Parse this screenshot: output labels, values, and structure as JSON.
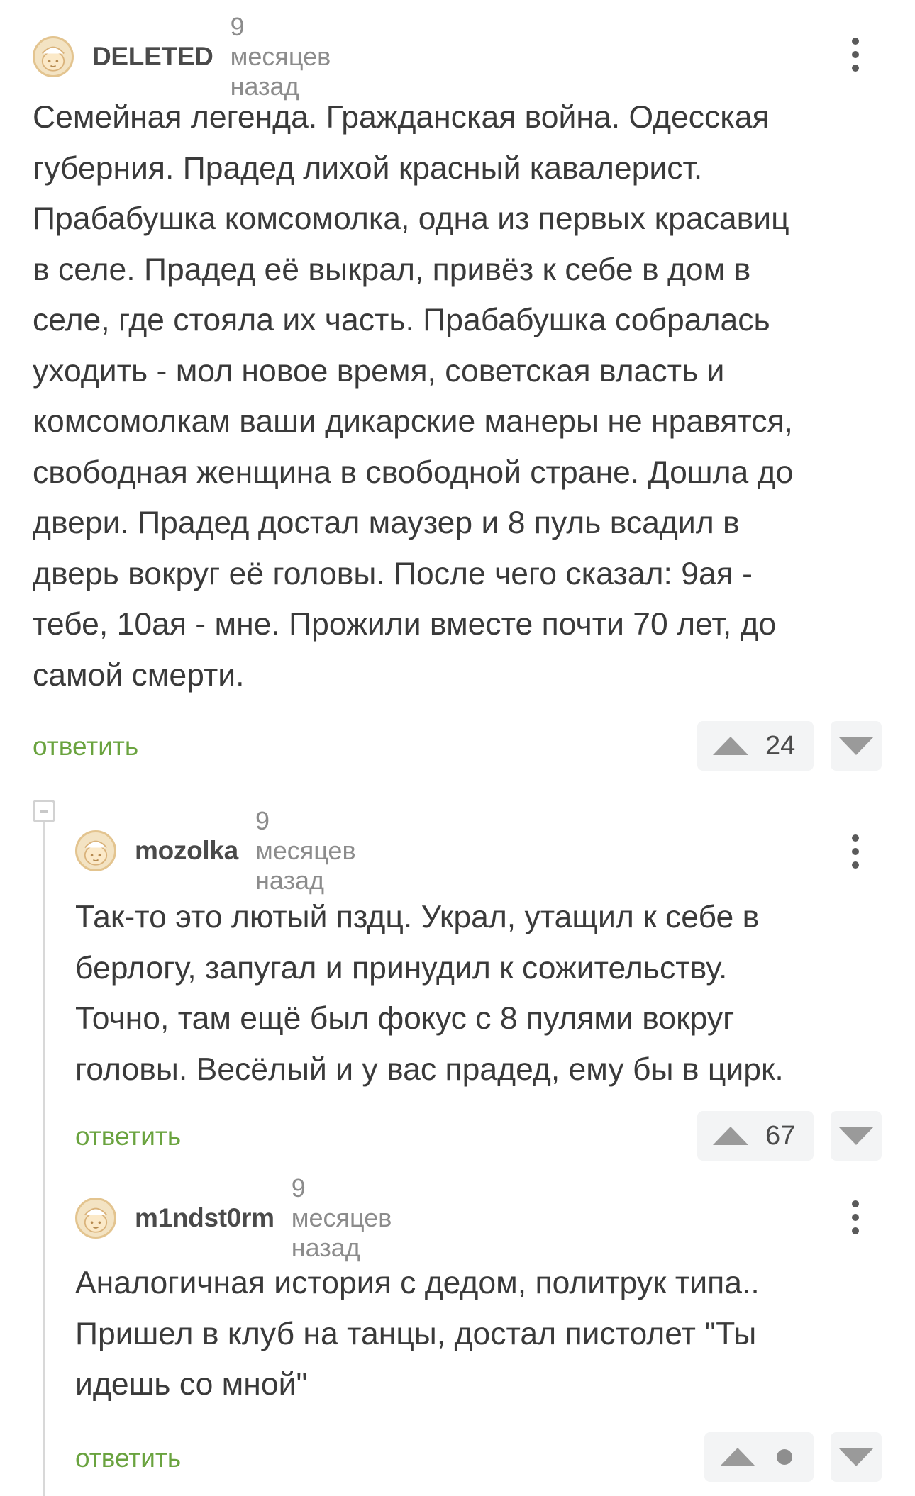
{
  "comments": [
    {
      "username": "DELETED",
      "time": "9 месяцев назад",
      "text": "Семейная легенда. Гражданская война. Одесская\nгуберния. Прадед лихой красный кавалерист.\nПрабабушка комсомолка, одна из первых красавиц\nв селе. Прадед её выкрал, привёз к себе в дом в\nселе, где стояла их часть. Прабабушка собралась\nуходить - мол новое время, советская власть и\nкомсомолкам ваши дикарские манеры не нравятся,\nсвободная женщина в свободной стране. Дошла до\nдвери. Прадед достал маузер и 8 пуль всадил в\nдверь вокруг её головы. После чего сказал: 9ая -\nтебе, 10ая - мне. Прожили вместе почти 70 лет, до\nсамой смерти.",
      "reply_label": "ответить",
      "votes": "24"
    },
    {
      "username": "mozolka",
      "time": "9 месяцев назад",
      "text": "Так-то это лютый пздц. Украл, утащил к себе в\nберлогу, запугал и принудил к сожительству.\nТочно, там ещё был фокус с 8 пулями вокруг\nголовы. Весёлый и у вас прадед, ему бы в цирк.",
      "reply_label": "ответить",
      "votes": "67"
    },
    {
      "username": "m1ndst0rm",
      "time": "9 месяцев назад",
      "text": "Аналогичная история с дедом, политрук типа..\nПришел в клуб на танцы, достал пистолет \"Ты\nидешь со мной\"",
      "reply_label": "ответить",
      "votes": ""
    }
  ],
  "icons": {
    "avatar": "default-avatar-icon",
    "more": "more-vertical-icon",
    "upvote": "arrow-up-icon",
    "downvote": "arrow-down-icon",
    "collapse": "collapse-thread-icon",
    "vote_hidden": "hidden-rating-dot-icon"
  },
  "colors": {
    "reply_link": "#6aa33f",
    "username": "#4a4a4a",
    "time": "#8c8c8c",
    "vote_bg": "#f3f4f5"
  }
}
